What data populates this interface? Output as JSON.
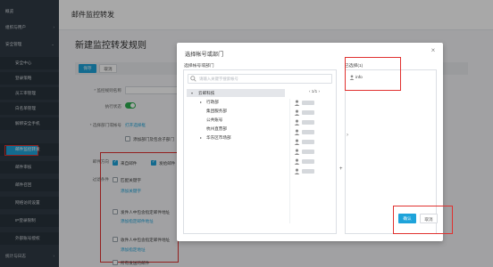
{
  "sidebar": {
    "items": [
      {
        "label": "概览",
        "type": "top"
      },
      {
        "label": "组织与用户",
        "type": "top",
        "chevron": "›"
      },
      {
        "label": "安全管理",
        "type": "top",
        "chevron": "⌄"
      },
      {
        "label": "安全中心",
        "type": "sub"
      },
      {
        "label": "登录策略",
        "type": "sub"
      },
      {
        "label": "员工审管理",
        "type": "sub"
      },
      {
        "label": "白名单管理",
        "type": "sub"
      },
      {
        "label": "解绑安全手机",
        "type": "sub"
      },
      {
        "label": "邮件监控转发",
        "type": "sub",
        "active": true
      },
      {
        "label": "邮件审核",
        "type": "sub"
      },
      {
        "label": "邮件召回",
        "type": "sub"
      },
      {
        "label": "网络访问设置",
        "type": "sub"
      },
      {
        "label": "IP登录限制",
        "type": "sub"
      },
      {
        "label": "外部账号授权",
        "type": "sub"
      },
      {
        "label": "统计与日志",
        "type": "top",
        "chevron": "›"
      }
    ]
  },
  "header": {
    "title": "邮件监控转发"
  },
  "page": {
    "subtitle": "新建监控转发规则",
    "save_label": "保存",
    "cancel_label": "取消",
    "form": {
      "rule_name_label": "* 监控规则名称",
      "status_label": "执行状态",
      "scope_label": "* 选择部门或帐号",
      "scope_link": "打开选择框",
      "include_sub": "添加部门及包含子部门",
      "direction_label": "邮件方向",
      "direction_1": "来自邮件",
      "direction_2": "发给邮件",
      "filter_label": "过滤条件",
      "filter_1": "匹配关键字",
      "filter_link_1": "添加关键字",
      "filter_2": "发件人中包含指定邮件地址",
      "filter_link_2": "添加指定邮件地址",
      "filter_3": "收件人中包含指定邮件地址",
      "filter_link_3": "添加指定地址",
      "filter_4": "所有发送的邮件"
    }
  },
  "modal": {
    "title": "选择帐号或部门",
    "close_label": "×",
    "left_label": "选择帐号或部门",
    "search_placeholder": "请输入关键字搜索帐号",
    "pager": "‹   1/1   ›",
    "tree": [
      {
        "label": "云邮科技",
        "level": 0,
        "caret": "▾",
        "selected": true
      },
      {
        "label": "行政部",
        "level": 1,
        "caret": "▸"
      },
      {
        "label": "集团服务部",
        "level": 1
      },
      {
        "label": "公共账号",
        "level": 1
      },
      {
        "label": "杭州直营部",
        "level": 1
      },
      {
        "label": "华东区市场部",
        "level": 1,
        "caret": "▸"
      }
    ],
    "member_count": 8,
    "plus": "+",
    "right_label": "已选择(1)",
    "chosen": "info",
    "ok_label": "确认",
    "cancel_label": "取消"
  },
  "icons": {
    "search": "search-icon",
    "user": "user-icon",
    "close": "close-icon",
    "chevron": "chevron-right-icon"
  },
  "colors": {
    "accent": "#1ea3da",
    "sidebar": "#2f3a45",
    "toggle_on": "#2dae50",
    "annotation": "#e0312f"
  }
}
